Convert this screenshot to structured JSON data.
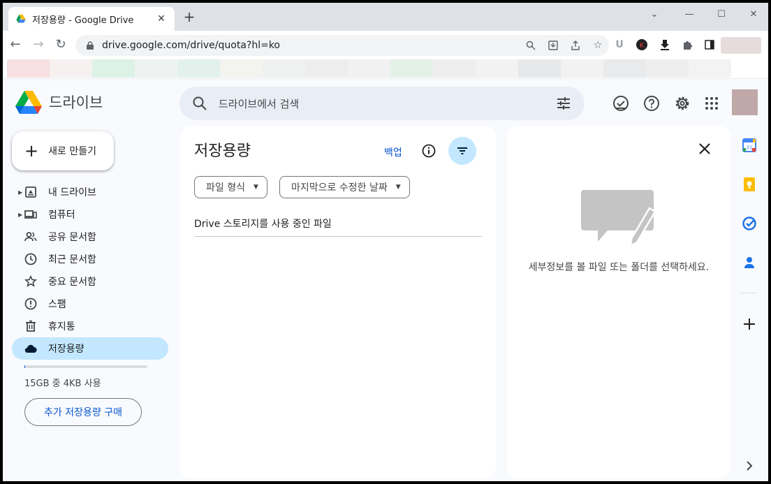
{
  "browser": {
    "tab_title": "저장용량 - Google Drive",
    "url": "drive.google.com/drive/quota?hl=ko"
  },
  "app": {
    "name": "드라이브",
    "search_placeholder": "드라이브에서 검색",
    "new_button": "새로 만들기"
  },
  "sidebar": {
    "items": [
      {
        "label": "내 드라이브",
        "icon": "my-drive-icon"
      },
      {
        "label": "컴퓨터",
        "icon": "computer-icon"
      },
      {
        "label": "공유 문서함",
        "icon": "people-icon"
      },
      {
        "label": "최근 문서함",
        "icon": "clock-icon"
      },
      {
        "label": "중요 문서함",
        "icon": "star-icon"
      },
      {
        "label": "스팸",
        "icon": "spam-icon"
      },
      {
        "label": "휴지통",
        "icon": "trash-icon"
      },
      {
        "label": "저장용량",
        "icon": "cloud-icon"
      }
    ],
    "quota_text": "15GB 중 4KB 사용",
    "quota_fraction": 0.001,
    "buy_storage": "추가 저장용량 구매"
  },
  "main": {
    "title": "저장용량",
    "backup_link": "백업",
    "filters": [
      "파일 형식",
      "마지막으로 수정한 날짜"
    ],
    "list_header": "Drive 스토리지를 사용 중인 파일"
  },
  "details": {
    "message": "세부정보를 볼 파일 또는 폴더를 선택하세요."
  },
  "colors": {
    "accent": "#0b57d0",
    "active_bg": "#c2e7ff",
    "search_bg": "#e9eef6",
    "app_bg": "#f8fafd"
  }
}
